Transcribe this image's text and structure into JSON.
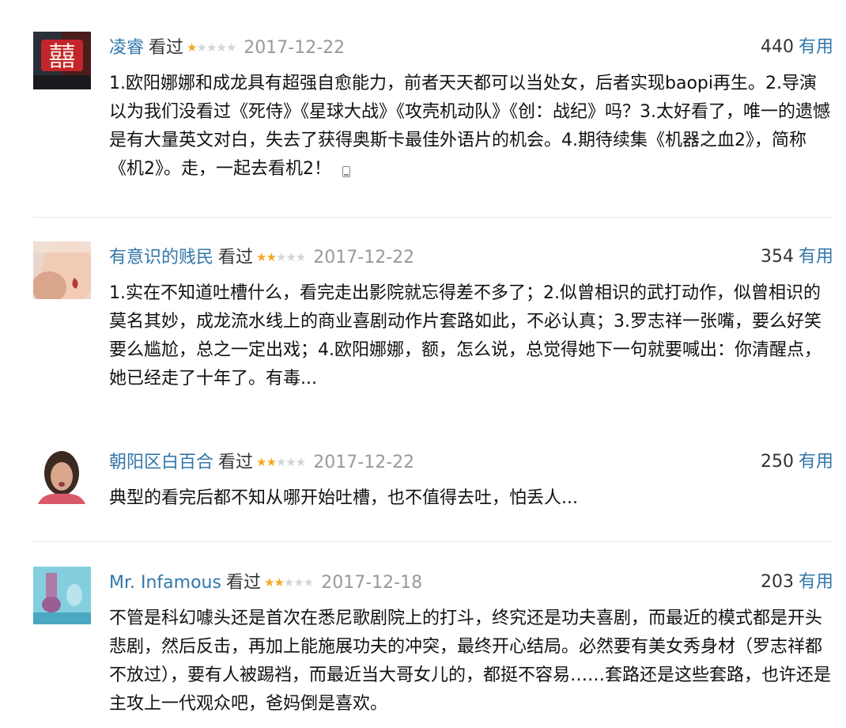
{
  "reviews": [
    {
      "author": "凌睿",
      "status": "看过",
      "rating": 1,
      "date": "2017-12-22",
      "votes": "440",
      "vote_label": "有用",
      "text": "1.欧阳娜娜和成龙具有超强自愈能力，前者天天都可以当处女，后者实现baopi再生。2.导演以为我们没看过《死侍》《星球大战》《攻壳机动队》《创：战纪》吗？3.太好看了，唯一的遗憾是有大量英文对白，失去了获得奥斯卡最佳外语片的机会。4.期待续集《机器之血2》，简称《机2》。走，一起去看机2！",
      "avatar": "double-happiness-avatar"
    },
    {
      "author": "有意识的贱民",
      "status": "看过",
      "rating": 2,
      "date": "2017-12-22",
      "votes": "354",
      "vote_label": "有用",
      "text": "1.实在不知道吐槽什么，看完走出影院就忘得差不多了；2.似曾相识的武打动作，似曾相识的莫名其妙，成龙流水线上的商业喜剧动作片套路如此，不必认真；3.罗志祥一张嘴，要么好笑要么尴尬，总之一定出戏；4.欧阳娜娜，额，怎么说，总觉得她下一句就要喊出：你清醒点，她已经走了十年了。有毒...",
      "avatar": "portrait-avatar"
    },
    {
      "author": "朝阳区白百合",
      "status": "看过",
      "rating": 2,
      "date": "2017-12-22",
      "votes": "250",
      "vote_label": "有用",
      "text": "典型的看完后都不知从哪开始吐槽，也不值得去吐，怕丢人...",
      "avatar": "woman-avatar"
    },
    {
      "author": "Mr. Infamous",
      "status": "看过",
      "rating": 2,
      "date": "2017-12-18",
      "votes": "203",
      "vote_label": "有用",
      "text": "不管是科幻噱头还是首次在悉尼歌剧院上的打斗，终究还是功夫喜剧，而最近的模式都是开头悲剧，然后反击，再加上能施展功夫的冲突，最终开心结局。必然要有美女秀身材（罗志祥都不放过），要有人被踢裆，而最近当大哥女儿的，都挺不容易……套路还是这些套路，也许还是主攻上一代观众吧，爸妈倒是喜欢。",
      "avatar": "blue-abstract-avatar"
    }
  ],
  "icons": {
    "mobile": "phone-icon"
  },
  "colors": {
    "link": "#3377aa",
    "star_on": "#f6a623",
    "star_off": "#d4d4d4",
    "meta": "#999999",
    "divider": "#e6e6e6"
  }
}
